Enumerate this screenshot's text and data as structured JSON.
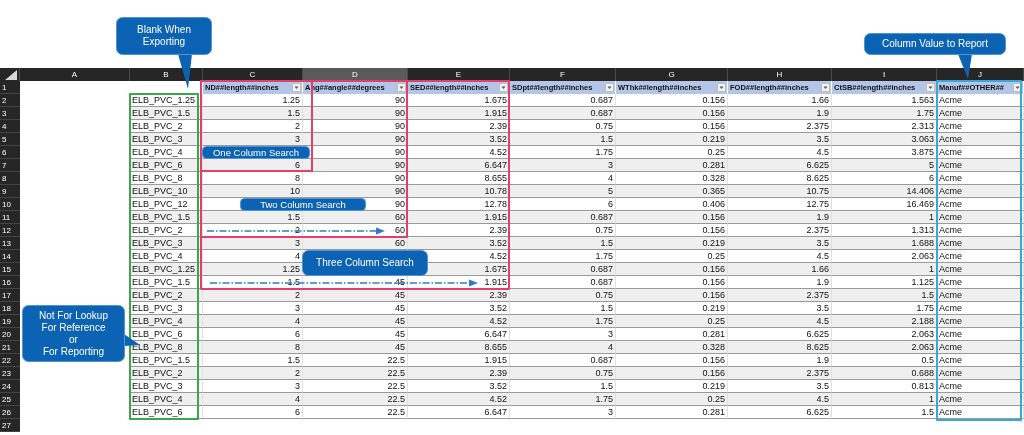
{
  "callouts_top": [
    {
      "text": "Blank When\nExporting",
      "kind": "tail_down"
    },
    {
      "text": "Column Value to Report",
      "kind": "tail_down"
    }
  ],
  "sheet": {
    "columns": [
      {
        "letter": "A",
        "selected": false
      },
      {
        "letter": "B",
        "selected": false
      },
      {
        "letter": "C",
        "selected": false
      },
      {
        "letter": "D",
        "selected": true
      },
      {
        "letter": "E",
        "selected": false
      },
      {
        "letter": "F",
        "selected": false
      },
      {
        "letter": "G",
        "selected": false
      },
      {
        "letter": "H",
        "selected": false
      },
      {
        "letter": "I",
        "selected": false
      },
      {
        "letter": "J",
        "selected": false
      }
    ],
    "row_numbers": [
      "1",
      "2",
      "3",
      "4",
      "5",
      "6",
      "7",
      "8",
      "9",
      "10",
      "11",
      "12",
      "13",
      "14",
      "15",
      "16",
      "17",
      "18",
      "19",
      "20",
      "21",
      "22",
      "23",
      "24",
      "25",
      "26",
      "27"
    ],
    "rows": [
      [
        "",
        "",
        "ND##length##inches",
        "Ang##angle##degrees",
        "SED##length##inches",
        "SDpt##length##inches",
        "WThk##length##inches",
        "FOD##length##inches",
        "CtSB##length##inches",
        "Manuf##OTHER##"
      ],
      [
        "",
        "ELB_PVC_1.25",
        "1.25",
        "90",
        "1.675",
        "0.687",
        "0.156",
        "1.66",
        "1.563",
        "Acme"
      ],
      [
        "",
        "ELB_PVC_1.5",
        "1.5",
        "90",
        "1.915",
        "0.687",
        "0.156",
        "1.9",
        "1.75",
        "Acme"
      ],
      [
        "",
        "ELB_PVC_2",
        "2",
        "90",
        "2.39",
        "0.75",
        "0.156",
        "2.375",
        "2.313",
        "Acme"
      ],
      [
        "",
        "ELB_PVC_3",
        "3",
        "90",
        "3.52",
        "1.5",
        "0.219",
        "3.5",
        "3.063",
        "Acme"
      ],
      [
        "",
        "ELB_PVC_4",
        null,
        "90",
        "4.52",
        "1.75",
        "0.25",
        "4.5",
        "3.875",
        "Acme"
      ],
      [
        "",
        "ELB_PVC_6",
        "6",
        "90",
        "6.647",
        "3",
        "0.281",
        "6.625",
        "5",
        "Acme"
      ],
      [
        "",
        "ELB_PVC_8",
        "8",
        "90",
        "8.655",
        "4",
        "0.328",
        "8.625",
        "6",
        "Acme"
      ],
      [
        "",
        "ELB_PVC_10",
        "10",
        "90",
        "10.78",
        "5",
        "0.365",
        "10.75",
        "14.406",
        "Acme"
      ],
      [
        "",
        "ELB_PVC_12",
        null,
        "90",
        "12.78",
        "6",
        "0.406",
        "12.75",
        "16.469",
        "Acme"
      ],
      [
        "",
        "ELB_PVC_1.5",
        "1.5",
        "60",
        "1.915",
        "0.687",
        "0.156",
        "1.9",
        "1",
        "Acme"
      ],
      [
        "",
        "ELB_PVC_2",
        "2",
        "60",
        "2.39",
        "0.75",
        "0.156",
        "2.375",
        "1.313",
        "Acme"
      ],
      [
        "",
        "ELB_PVC_3",
        "3",
        "60",
        "3.52",
        "1.5",
        "0.219",
        "3.5",
        "1.688",
        "Acme"
      ],
      [
        "",
        "ELB_PVC_4",
        "4",
        null,
        "4.52",
        "1.75",
        "0.25",
        "4.5",
        "2.063",
        "Acme"
      ],
      [
        "",
        "ELB_PVC_1.25",
        "1.25",
        null,
        "1.675",
        "0.687",
        "0.156",
        "1.66",
        "1",
        "Acme"
      ],
      [
        "",
        "ELB_PVC_1.5",
        "1.5",
        "45",
        "1.915",
        "0.687",
        "0.156",
        "1.9",
        "1.125",
        "Acme"
      ],
      [
        "",
        "ELB_PVC_2",
        "2",
        "45",
        "2.39",
        "0.75",
        "0.156",
        "2.375",
        "1.5",
        "Acme"
      ],
      [
        "",
        "ELB_PVC_3",
        "3",
        "45",
        "3.52",
        "1.5",
        "0.219",
        "3.5",
        "1.75",
        "Acme"
      ],
      [
        "",
        "ELB_PVC_4",
        "4",
        "45",
        "4.52",
        "1.75",
        "0.25",
        "4.5",
        "2.188",
        "Acme"
      ],
      [
        "",
        "ELB_PVC_6",
        "6",
        "45",
        "6.647",
        "3",
        "0.281",
        "6.625",
        "2.063",
        "Acme"
      ],
      [
        "",
        "ELB_PVC_8",
        "8",
        "45",
        "8.655",
        "4",
        "0.328",
        "8.625",
        "2.063",
        "Acme"
      ],
      [
        "",
        "ELB_PVC_1.5",
        "1.5",
        "22.5",
        "1.915",
        "0.687",
        "0.156",
        "1.9",
        "0.5",
        "Acme"
      ],
      [
        "",
        "ELB_PVC_2",
        "2",
        "22.5",
        "2.39",
        "0.75",
        "0.156",
        "2.375",
        "0.688",
        "Acme"
      ],
      [
        "",
        "ELB_PVC_3",
        "3",
        "22.5",
        "3.52",
        "1.5",
        "0.219",
        "3.5",
        "0.813",
        "Acme"
      ],
      [
        "",
        "ELB_PVC_4",
        "4",
        "22.5",
        "4.52",
        "1.75",
        "0.25",
        "4.5",
        "1",
        "Acme"
      ],
      [
        "",
        "ELB_PVC_6",
        "6",
        "22.5",
        "6.647",
        "3",
        "0.281",
        "6.625",
        "1.5",
        "Acme"
      ]
    ]
  },
  "callouts_sheet": [
    {
      "text": "One Column Search",
      "kind": "plain"
    },
    {
      "text": "Two Column Search",
      "kind": "plain"
    },
    {
      "text": "Three Column Search",
      "kind": "plain"
    },
    {
      "text": "Not For Lookup\nFor Reference\nor\nFor Reporting",
      "kind": "tail_right"
    }
  ]
}
